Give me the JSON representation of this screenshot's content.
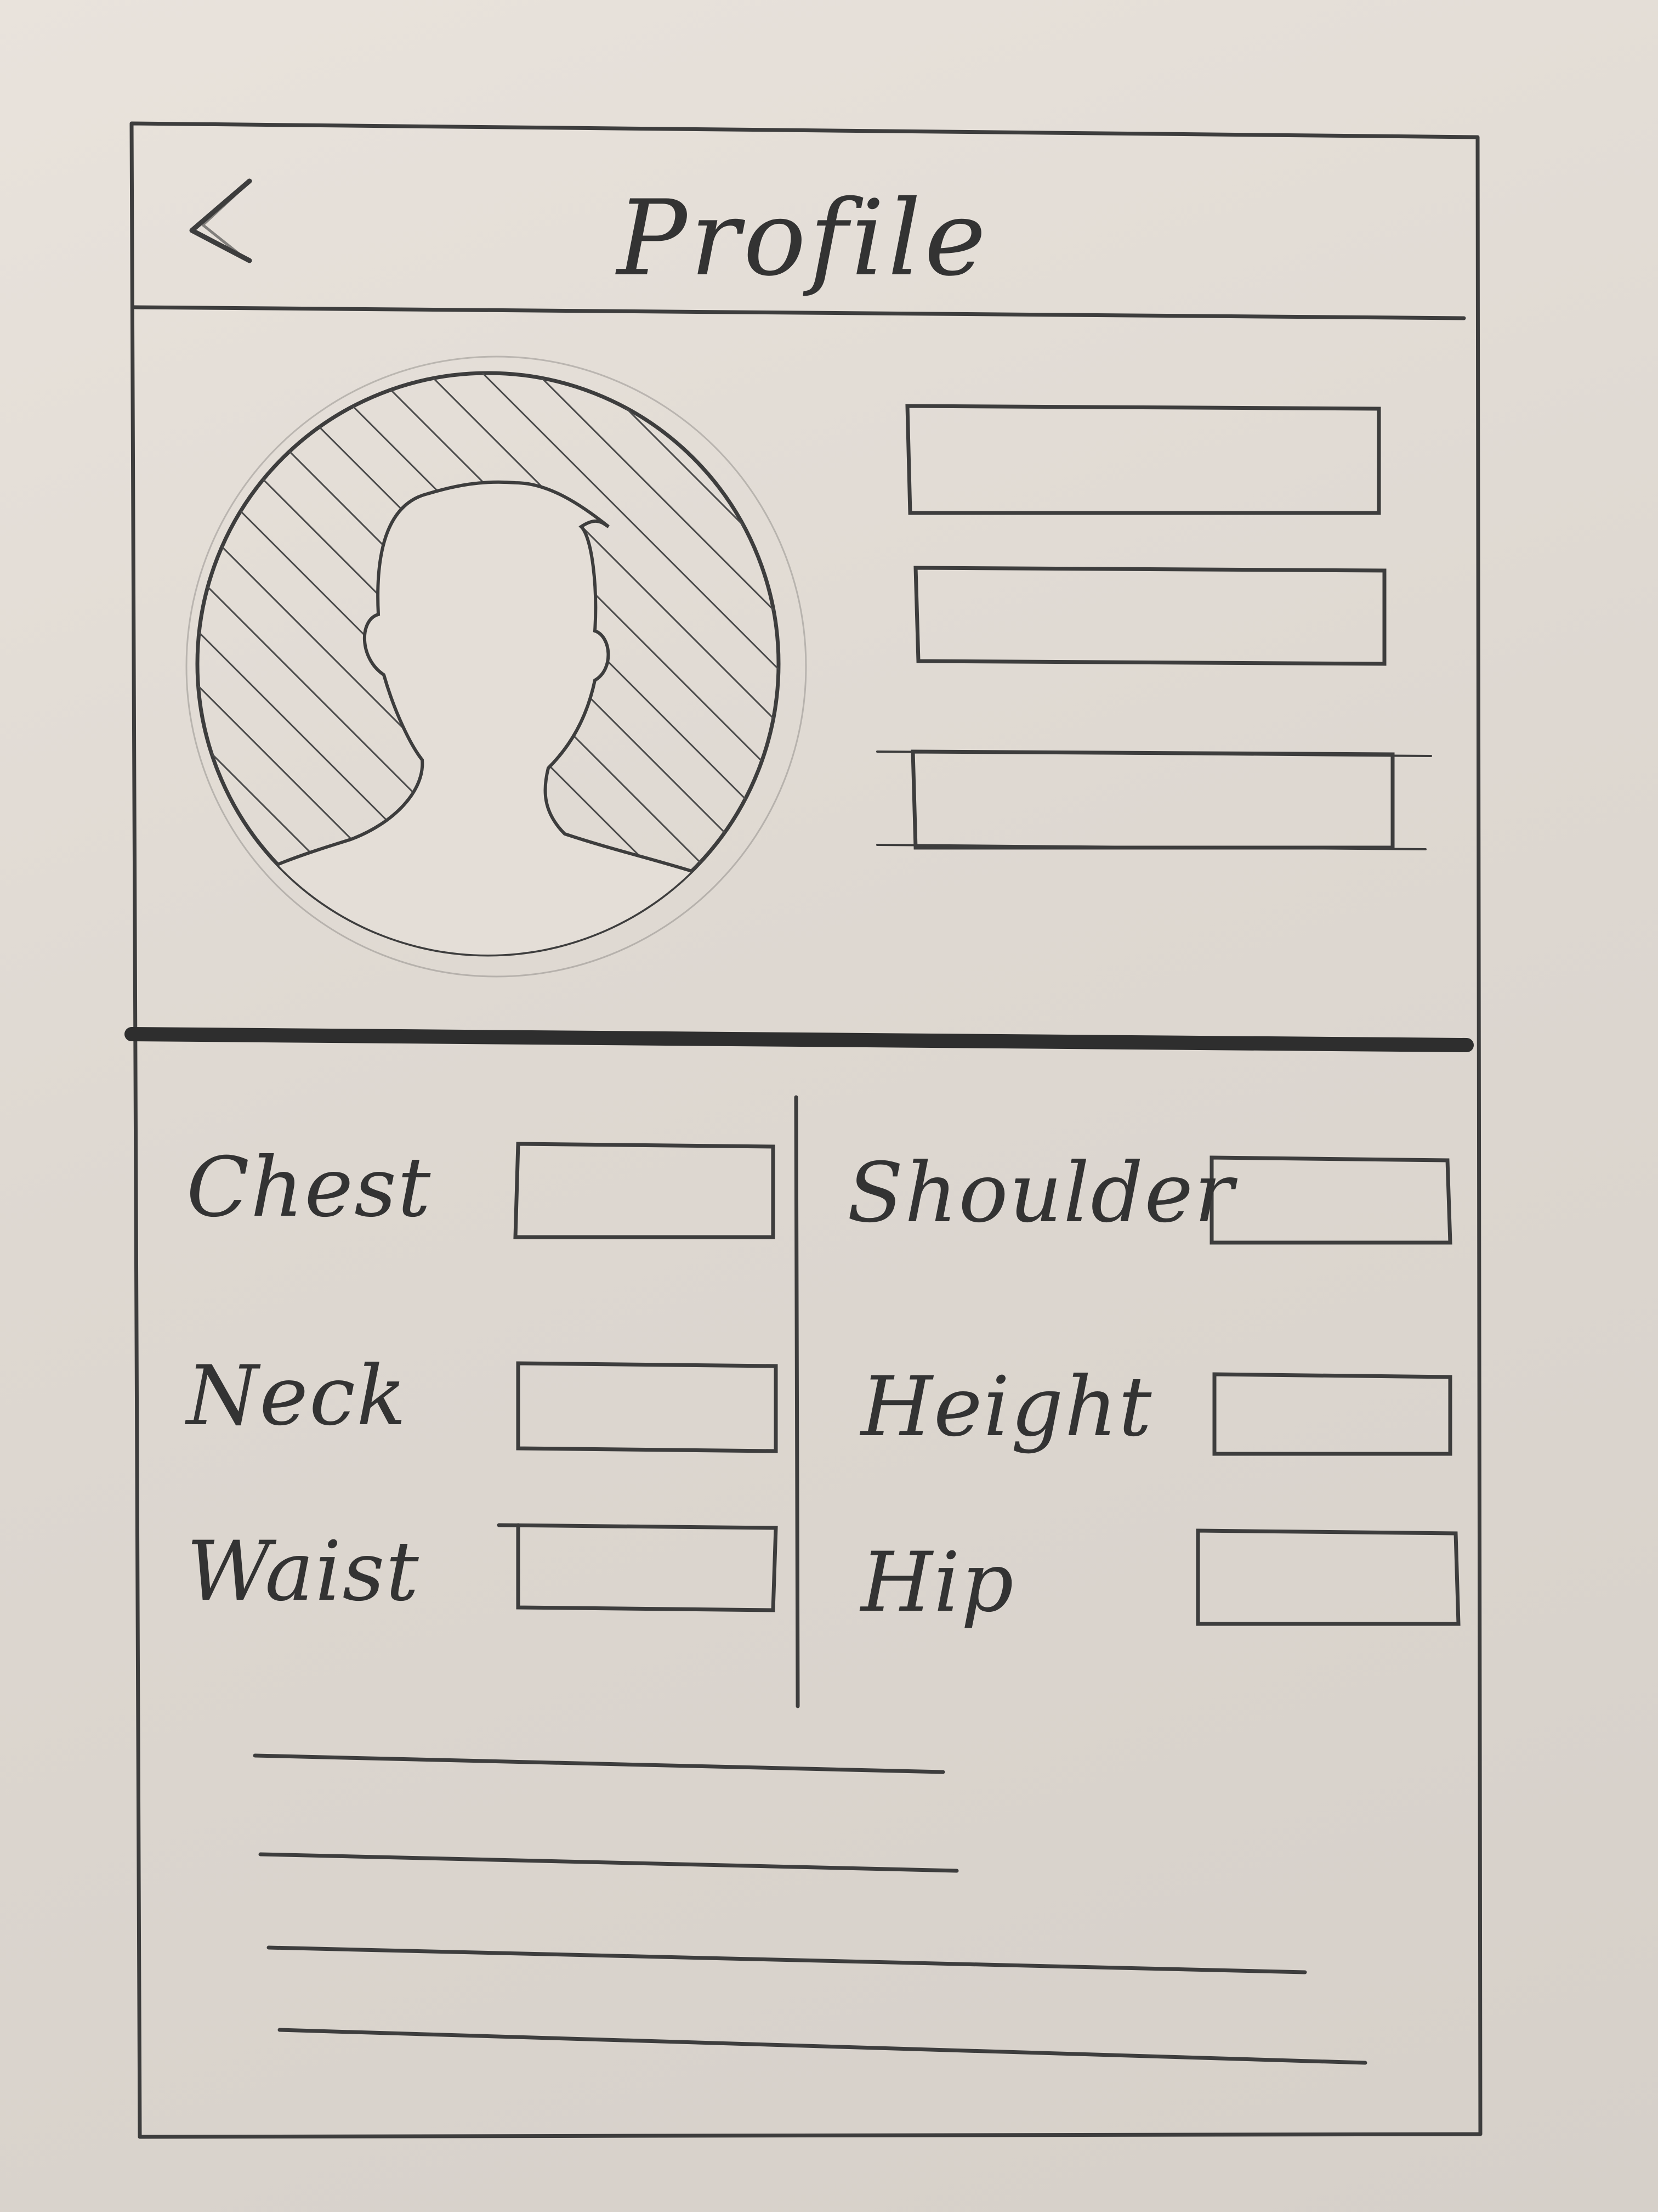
{
  "header": {
    "title": "Profile",
    "back_icon": "chevron-left-icon"
  },
  "profile": {
    "avatar_icon": "user-silhouette-icon"
  },
  "measurements": {
    "left": [
      {
        "label": "Chest"
      },
      {
        "label": "Neck"
      },
      {
        "label": "Waist"
      }
    ],
    "right": [
      {
        "label": "Shoulder"
      },
      {
        "label": "Height"
      },
      {
        "label": "Hip"
      }
    ]
  },
  "colors": {
    "paper": "#e4ded7",
    "pencil": "#3a3a3a"
  }
}
